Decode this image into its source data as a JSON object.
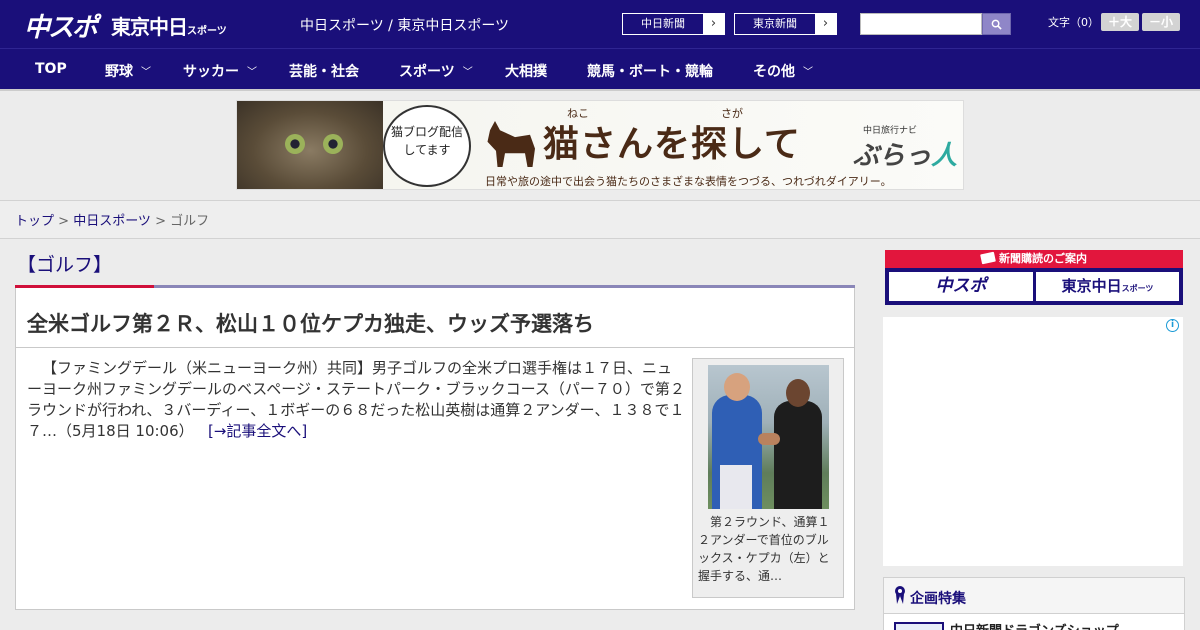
{
  "header": {
    "logo_chuspo": "中スポ",
    "logo_tokyo_main": "東京中日",
    "logo_tokyo_small": "スポーツ",
    "site_title": "中日スポーツ / 東京中日スポーツ",
    "btn_chunichi": "中日新聞",
    "btn_tokyo": "東京新聞",
    "font_label": "文字（0）",
    "font_big": "＋大",
    "font_small": "－小"
  },
  "nav": {
    "items": [
      {
        "label": "TOP",
        "has_menu": false
      },
      {
        "label": "野球",
        "has_menu": true
      },
      {
        "label": "サッカー",
        "has_menu": true
      },
      {
        "label": "芸能・社会",
        "has_menu": false
      },
      {
        "label": "スポーツ",
        "has_menu": true
      },
      {
        "label": "大相撲",
        "has_menu": false
      },
      {
        "label": "競馬・ボート・競輪",
        "has_menu": false
      },
      {
        "label": "その他",
        "has_menu": true
      }
    ]
  },
  "banner": {
    "bubble_text": "猫ブログ配信してます",
    "title": "猫さんを探して",
    "ruby_neko": "ねこ",
    "ruby_saga": "さが",
    "subtitle": "日常や旅の途中で出会う猫たちのさまざまな表情をつづる、つれづれダイアリー。",
    "brand_small": "中日旅行ナビ",
    "brand_main": "ぶらっ",
    "brand_accent": "人"
  },
  "breadcrumb": {
    "top": "トップ",
    "sep1": " > ",
    "parent": "中日スポーツ",
    "sep2": " > ",
    "current": "ゴルフ"
  },
  "section": {
    "title": "【ゴルフ】"
  },
  "article": {
    "title": "全米ゴルフ第２Ｒ、松山１０位ケプカ独走、ウッズ予選落ち",
    "body": "【ファミングデール（米ニューヨーク州）共同】男子ゴルフの全米プロ選手権は１７日、ニューヨーク州ファミングデールのベスページ・ステートパーク・ブラックコース（パー７０）で第２ラウンドが行われ、３バーディー、１ボギーの６８だった松山英樹は通算２アンダー、１３８で１７…（5月18日 10:06）",
    "more": "[→記事全文へ]",
    "caption": "第２ラウンド、通算１２アンダーで首位のブルックス・ケプカ（左）と握手する、通…"
  },
  "sidebar": {
    "subscribe_head": "新聞購読のご案内",
    "sub_chuspo": "中スポ",
    "sub_tokyo": "東京中日",
    "sub_tokyo_small": "スポーツ",
    "ad_info": "i",
    "feature_title": "企画特集",
    "feature_item": "中日新聞ドラゴンズショップ"
  },
  "colors": {
    "brand_navy": "#1a0f7a",
    "accent_red": "#d0103a"
  }
}
